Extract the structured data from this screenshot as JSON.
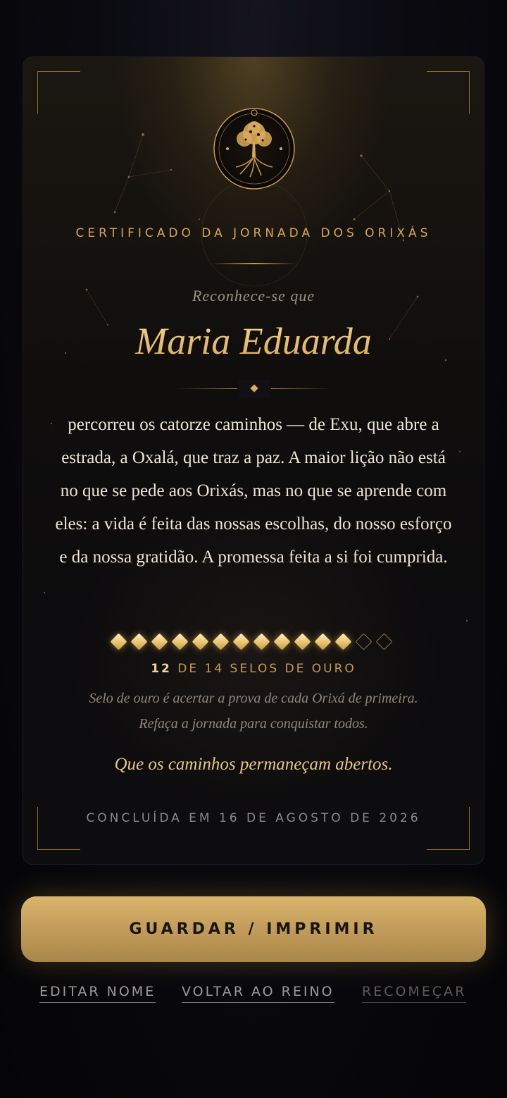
{
  "certificate": {
    "title": "CERTIFICADO DA JORNADA DOS ORIXÁS",
    "intro": "Reconhece-se que",
    "name": "Maria Eduarda",
    "message": "percorreu os catorze caminhos — de Exu, que abre a estrada, a Oxalá, que traz a paz. A maior lição não está no que se pede aos Orixás, mas no que se aprende com eles: a vida é feita das nossas escolhas, do nosso esforço e da nossa gratidão. A promessa feita a si foi cumprida.",
    "emblem_icon": "tree-of-life-emblem-icon",
    "seals": {
      "earned": 12,
      "total": 14,
      "earned_label": "12",
      "count_label": "DE 14 SELOS DE OURO",
      "note_line1": "Selo de ouro é acertar a prova de cada Orixá de primeira.",
      "note_line2": "Refaça a jornada para conquistar todos.",
      "earned_color": "#e6bf6a",
      "empty_color": "#8a7a5c"
    },
    "blessing": "Que os caminhos permaneçam abertos.",
    "completed": "CONCLUÍDA EM 16 DE AGOSTO DE 2026"
  },
  "actions": {
    "print_label": "GUARDAR / IMPRIMIR",
    "edit_name_label": "EDITAR NOME",
    "back_label": "VOLTAR AO REINO",
    "restart_label": "RECOMEÇAR"
  },
  "colors": {
    "gold": "#d3a75a",
    "background": "#07070b",
    "button": "#c8a25e"
  }
}
